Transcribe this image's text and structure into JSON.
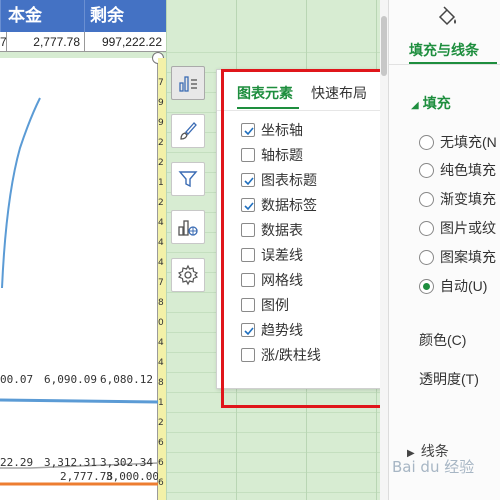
{
  "sheet": {
    "headers": [
      "本金",
      "剩余"
    ],
    "row": {
      "col0": "7",
      "col1": "2,777.78",
      "col2": "997,222.22"
    },
    "row_numbers": [
      "7",
      "9",
      "9",
      "2",
      "2",
      "1",
      "2",
      "4",
      "4",
      "4",
      "7",
      "8",
      "0",
      "4",
      "4",
      "8",
      "1",
      "2",
      "6",
      "6",
      "6"
    ]
  },
  "chart_data": {
    "type": "line",
    "visible_labels": {
      "upper": [
        "00.07",
        "6,090.09",
        "6,080.12"
      ],
      "lower_a": [
        "22.29",
        "3,312.31",
        "3,302.34"
      ],
      "lower_b": [
        "2,777.78",
        "3,000.00"
      ]
    },
    "colors": {
      "upper": "#5b9bd5",
      "lower_a": "#ed7d31",
      "trend_line": "#a5a5a5"
    }
  },
  "tools": {
    "items": [
      {
        "icon": "chart-elements-icon",
        "active": true
      },
      {
        "icon": "chart-style-brush-icon"
      },
      {
        "icon": "chart-filter-icon"
      },
      {
        "icon": "chart-layout-icon"
      },
      {
        "icon": "chart-settings-gear-icon"
      }
    ]
  },
  "popup": {
    "tabs": [
      "图表元素",
      "快速布局"
    ],
    "active_tab": 0,
    "options": [
      {
        "label": "坐标轴",
        "checked": true
      },
      {
        "label": "轴标题",
        "checked": false
      },
      {
        "label": "图表标题",
        "checked": true
      },
      {
        "label": "数据标签",
        "checked": true
      },
      {
        "label": "数据表",
        "checked": false
      },
      {
        "label": "误差线",
        "checked": false
      },
      {
        "label": "网格线",
        "checked": false
      },
      {
        "label": "图例",
        "checked": false
      },
      {
        "label": "趋势线",
        "checked": true
      },
      {
        "label": "涨/跌柱线",
        "checked": false
      }
    ],
    "highlight_color": "#e0161b"
  },
  "pane": {
    "tab": "填充与线条",
    "section": "填充",
    "fill_options": [
      {
        "label": "无填充(N",
        "selected": false
      },
      {
        "label": "纯色填充",
        "selected": false
      },
      {
        "label": "渐变填充",
        "selected": false
      },
      {
        "label": "图片或纹",
        "selected": false
      },
      {
        "label": "图案填充",
        "selected": false
      },
      {
        "label": "自动(U)",
        "selected": true
      }
    ],
    "color_label": "颜色(C)",
    "transparency_label": "透明度(T)",
    "line_section": "线条",
    "accent": "#1e8e3e"
  },
  "watermark": "Bai du 经验"
}
